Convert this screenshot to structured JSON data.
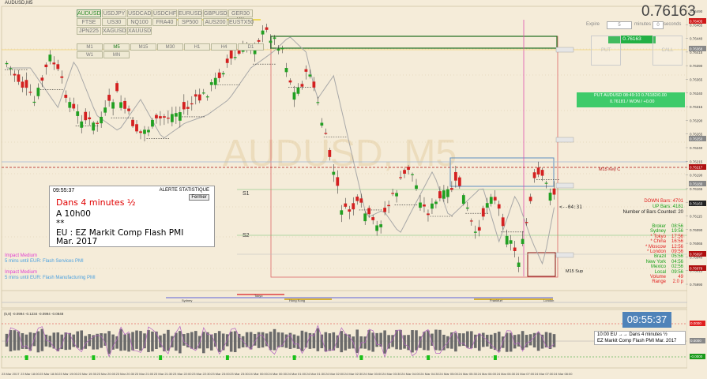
{
  "window": {
    "title": "AUDUSD,M5",
    "big_price": "0.76163"
  },
  "symbols": {
    "row1": [
      "AUDUSD",
      "USDJPY",
      "USDCAD",
      "USDCHF",
      "EURUSD",
      "GBPUSD",
      "GER30"
    ],
    "row2": [
      "FTSE 100",
      "US30",
      "NQ100",
      "FRA40",
      "SP500",
      "AUS200",
      "EUSTX50"
    ],
    "row3": [
      "JPN225",
      "XAGUSD",
      "XAUUSD"
    ],
    "selected": "AUDUSD"
  },
  "timeframes": {
    "row1": [
      "M1",
      "M5",
      "M15",
      "M30",
      "H1",
      "H4",
      "D1"
    ],
    "row2": [
      "W1",
      "MN"
    ],
    "selected": "M5"
  },
  "watermark": "AUDUSD, M5",
  "trade": {
    "expire_label": "Expire",
    "expire_value": "5",
    "expire_unit": "minutes",
    "seconds_value": "0",
    "seconds_label": "seconds",
    "price_box": "0.76163",
    "put_label": "PUT",
    "call_label": "CALL",
    "result_line1": "PUT AUDUSD 08:49:10 0.76182/0.00",
    "result_line2": "0.76181 / WON / +0.00"
  },
  "alert": {
    "time": "09:55:37",
    "header": "ALERTE STATISTIQUE",
    "close_label": "Fermer",
    "line1": "Dans 4 minutes ½",
    "line2": "A 10h00",
    "line3": "**",
    "line4": "EU : EZ Markit Comp Flash PMI",
    "line5": "Mar. 2017"
  },
  "impacts": [
    {
      "title": "Impact Medium",
      "detail": "5 mins until EUR: Flash Services PMI"
    },
    {
      "title": "Impact Medium",
      "detail": "5 mins until EUR: Flash Manufacturing PMI"
    }
  ],
  "stats": {
    "down_bars": "DOWN Bars: 4701",
    "up_bars": "UP Bars: 4181",
    "counted": "Number of Bars Counted: 20",
    "countdown": "<--04:31"
  },
  "sessions": [
    {
      "name": "Broker",
      "time": "08:56",
      "color": "#1aa01a"
    },
    {
      "name": "Sydney",
      "time": "19:56",
      "color": "#1aa01a"
    },
    {
      "name": "* Tokyo",
      "time": "17:56",
      "color": "#e02020"
    },
    {
      "name": "* China",
      "time": "16:56",
      "color": "#e02020"
    },
    {
      "name": "* Moscow",
      "time": "12:56",
      "color": "#e02020"
    },
    {
      "name": "* London",
      "time": "09:56",
      "color": "#e02020"
    },
    {
      "name": "Brazil",
      "time": "05:56",
      "color": "#1aa01a"
    },
    {
      "name": "New York",
      "time": "04:56",
      "color": "#1aa01a"
    },
    {
      "name": "Mexico",
      "time": "02:56",
      "color": "#1aa01a"
    },
    {
      "name": "Local",
      "time": "09:56",
      "color": "#1aa01a"
    },
    {
      "name": "Volume",
      "time": "49",
      "color": "#e02020"
    },
    {
      "name": "Range",
      "time": "2.0 p",
      "color": "#e02020"
    }
  ],
  "chart_labels": {
    "s1": "S1",
    "s2": "S2",
    "m15_key": "M15 Key C",
    "m15_sup": "M15 Sup",
    "hh": "HH"
  },
  "price_axis": [
    "0.76490",
    "0.76465",
    "0.76440",
    "0.76415",
    "0.76390",
    "0.76365",
    "0.76340",
    "0.76315",
    "0.76290",
    "0.76265",
    "0.76240",
    "0.76215",
    "0.76190",
    "0.76165",
    "0.76140",
    "0.76115",
    "0.76090",
    "0.76065",
    "0.76040",
    "0.76015",
    "0.75990"
  ],
  "price_markers": [
    {
      "value": "0.76405",
      "color": "#d01818"
    },
    {
      "value": "0.76368",
      "color": "#888"
    },
    {
      "value": "0.76250",
      "color": "#888"
    },
    {
      "value": "0.76217",
      "color": "#b01010"
    },
    {
      "value": "0.76180",
      "color": "#888"
    },
    {
      "value": "0.76163",
      "color": "#222"
    },
    {
      "value": "0.76097",
      "color": "#b01010"
    },
    {
      "value": "0.76079",
      "color": "#b01010"
    }
  ],
  "session_bar_labels": [
    "Sydney",
    "Tokyo",
    "Hong Kong",
    "Frankfurt",
    "London"
  ],
  "oscillator": {
    "header": "(5,8) -0.0994 -0.1234 -0.0994 -0.0848",
    "levels": [
      "0.0000",
      "0.0000",
      "-0.0000"
    ]
  },
  "news_panel": {
    "clock": "09:55:37",
    "line1": "10:00 EU →→ Dans 4 minutes ½",
    "line2": "EZ Markit Comp Flash PMI Mar. 2017"
  },
  "time_axis": [
    "23 Mar 2017",
    "23 Mar 18:00",
    "23 Mar 18:30",
    "23 Mar 19:00",
    "23 Mar 19:30",
    "23 Mar 20:00",
    "23 Mar 20:30",
    "23 Mar 21:00",
    "23 Mar 21:30",
    "23 Mar 22:00",
    "23 Mar 22:30",
    "23 Mar 23:00",
    "23 Mar 23:30",
    "24 Mar 00:00",
    "24 Mar 00:30",
    "24 Mar 01:00",
    "24 Mar 01:30",
    "24 Mar 02:00",
    "24 Mar 02:30",
    "24 Mar 03:00",
    "24 Mar 03:30",
    "24 Mar 04:00",
    "24 Mar 04:30",
    "24 Mar 05:00",
    "24 Mar 05:30",
    "24 Mar 06:00",
    "24 Mar 06:30",
    "24 Mar 07:00",
    "24 Mar 07:30",
    "24 Mar 08:00"
  ],
  "colors": {
    "bull": "#22a022",
    "bear": "#d42020",
    "background": "#f5ecd9",
    "accent_green": "#3ecb6a",
    "clock_blue": "#4f83b9"
  }
}
